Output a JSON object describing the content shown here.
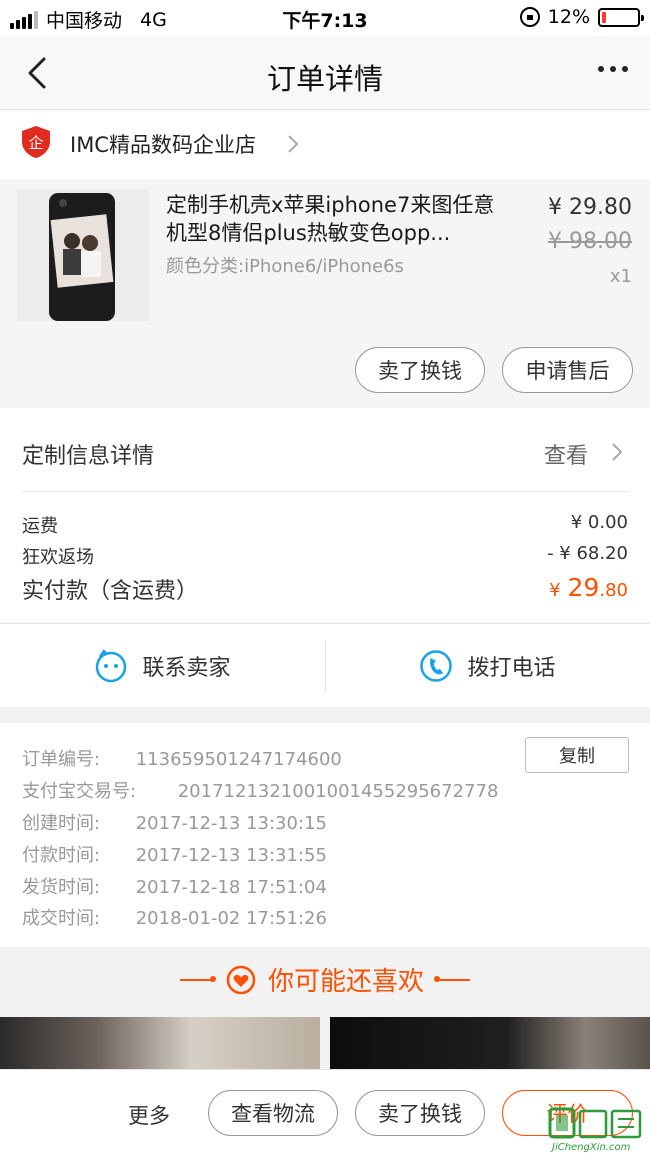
{
  "status_bar": {
    "carrier": "中国移动",
    "network": "4G",
    "time": "下午7:13",
    "battery_text": "12%",
    "battery_level": 0.12
  },
  "nav": {
    "title": "订单详情"
  },
  "shop": {
    "badge_char": "企",
    "name": "IMC精品数码企业店"
  },
  "product": {
    "title": "定制手机壳x苹果iphone7来图任意机型8情侣plus热敏变色opp...",
    "spec": "颜色分类:iPhone6/iPhone6s",
    "price": "¥ 29.80",
    "original_price": "¥ 98.00",
    "quantity": "x1",
    "buttons": {
      "sell": "卖了换钱",
      "after_sale": "申请售后"
    }
  },
  "custom_info": {
    "label": "定制信息详情",
    "view": "查看"
  },
  "fees": {
    "shipping_label": "运费",
    "shipping_value": "¥ 0.00",
    "carnival_label": "狂欢返场",
    "carnival_value": "- ¥ 68.20",
    "paid_label": "实付款（含运费）",
    "paid_symbol": "¥",
    "paid_int": "29",
    "paid_dec": ".80"
  },
  "contact": {
    "seller": "联系卖家",
    "phone": "拨打电话"
  },
  "order_info": {
    "copy_label": "复制",
    "rows": [
      {
        "label": "订单编号:",
        "value": "113659501247174600"
      },
      {
        "label": "支付宝交易号:",
        "value": "2017121321001001455295672778"
      },
      {
        "label": "创建时间:",
        "value": "2017-12-13 13:30:15"
      },
      {
        "label": "付款时间:",
        "value": "2017-12-13 13:31:55"
      },
      {
        "label": "发货时间:",
        "value": "2017-12-18 17:51:04"
      },
      {
        "label": "成交时间:",
        "value": "2018-01-02 17:51:26"
      }
    ]
  },
  "recommend": {
    "title": "你可能还喜欢"
  },
  "bottom_bar": {
    "more": "更多",
    "logistics": "查看物流",
    "sell": "卖了换钱",
    "review": "评价"
  },
  "watermark": {
    "text": "JiChengXin.com"
  },
  "colors": {
    "accent": "#ff5000",
    "icon_blue": "#1ba1e6",
    "badge_red": "#e02b1f",
    "watermark_green": "#2d9b3a"
  },
  "icons": {
    "back": "chevron-left-icon",
    "more": "more-dots-icon",
    "shop_badge": "enterprise-badge-icon",
    "chevron": "chevron-right-icon",
    "chat": "chat-face-icon",
    "phone": "phone-icon",
    "heart": "heart-icon"
  }
}
